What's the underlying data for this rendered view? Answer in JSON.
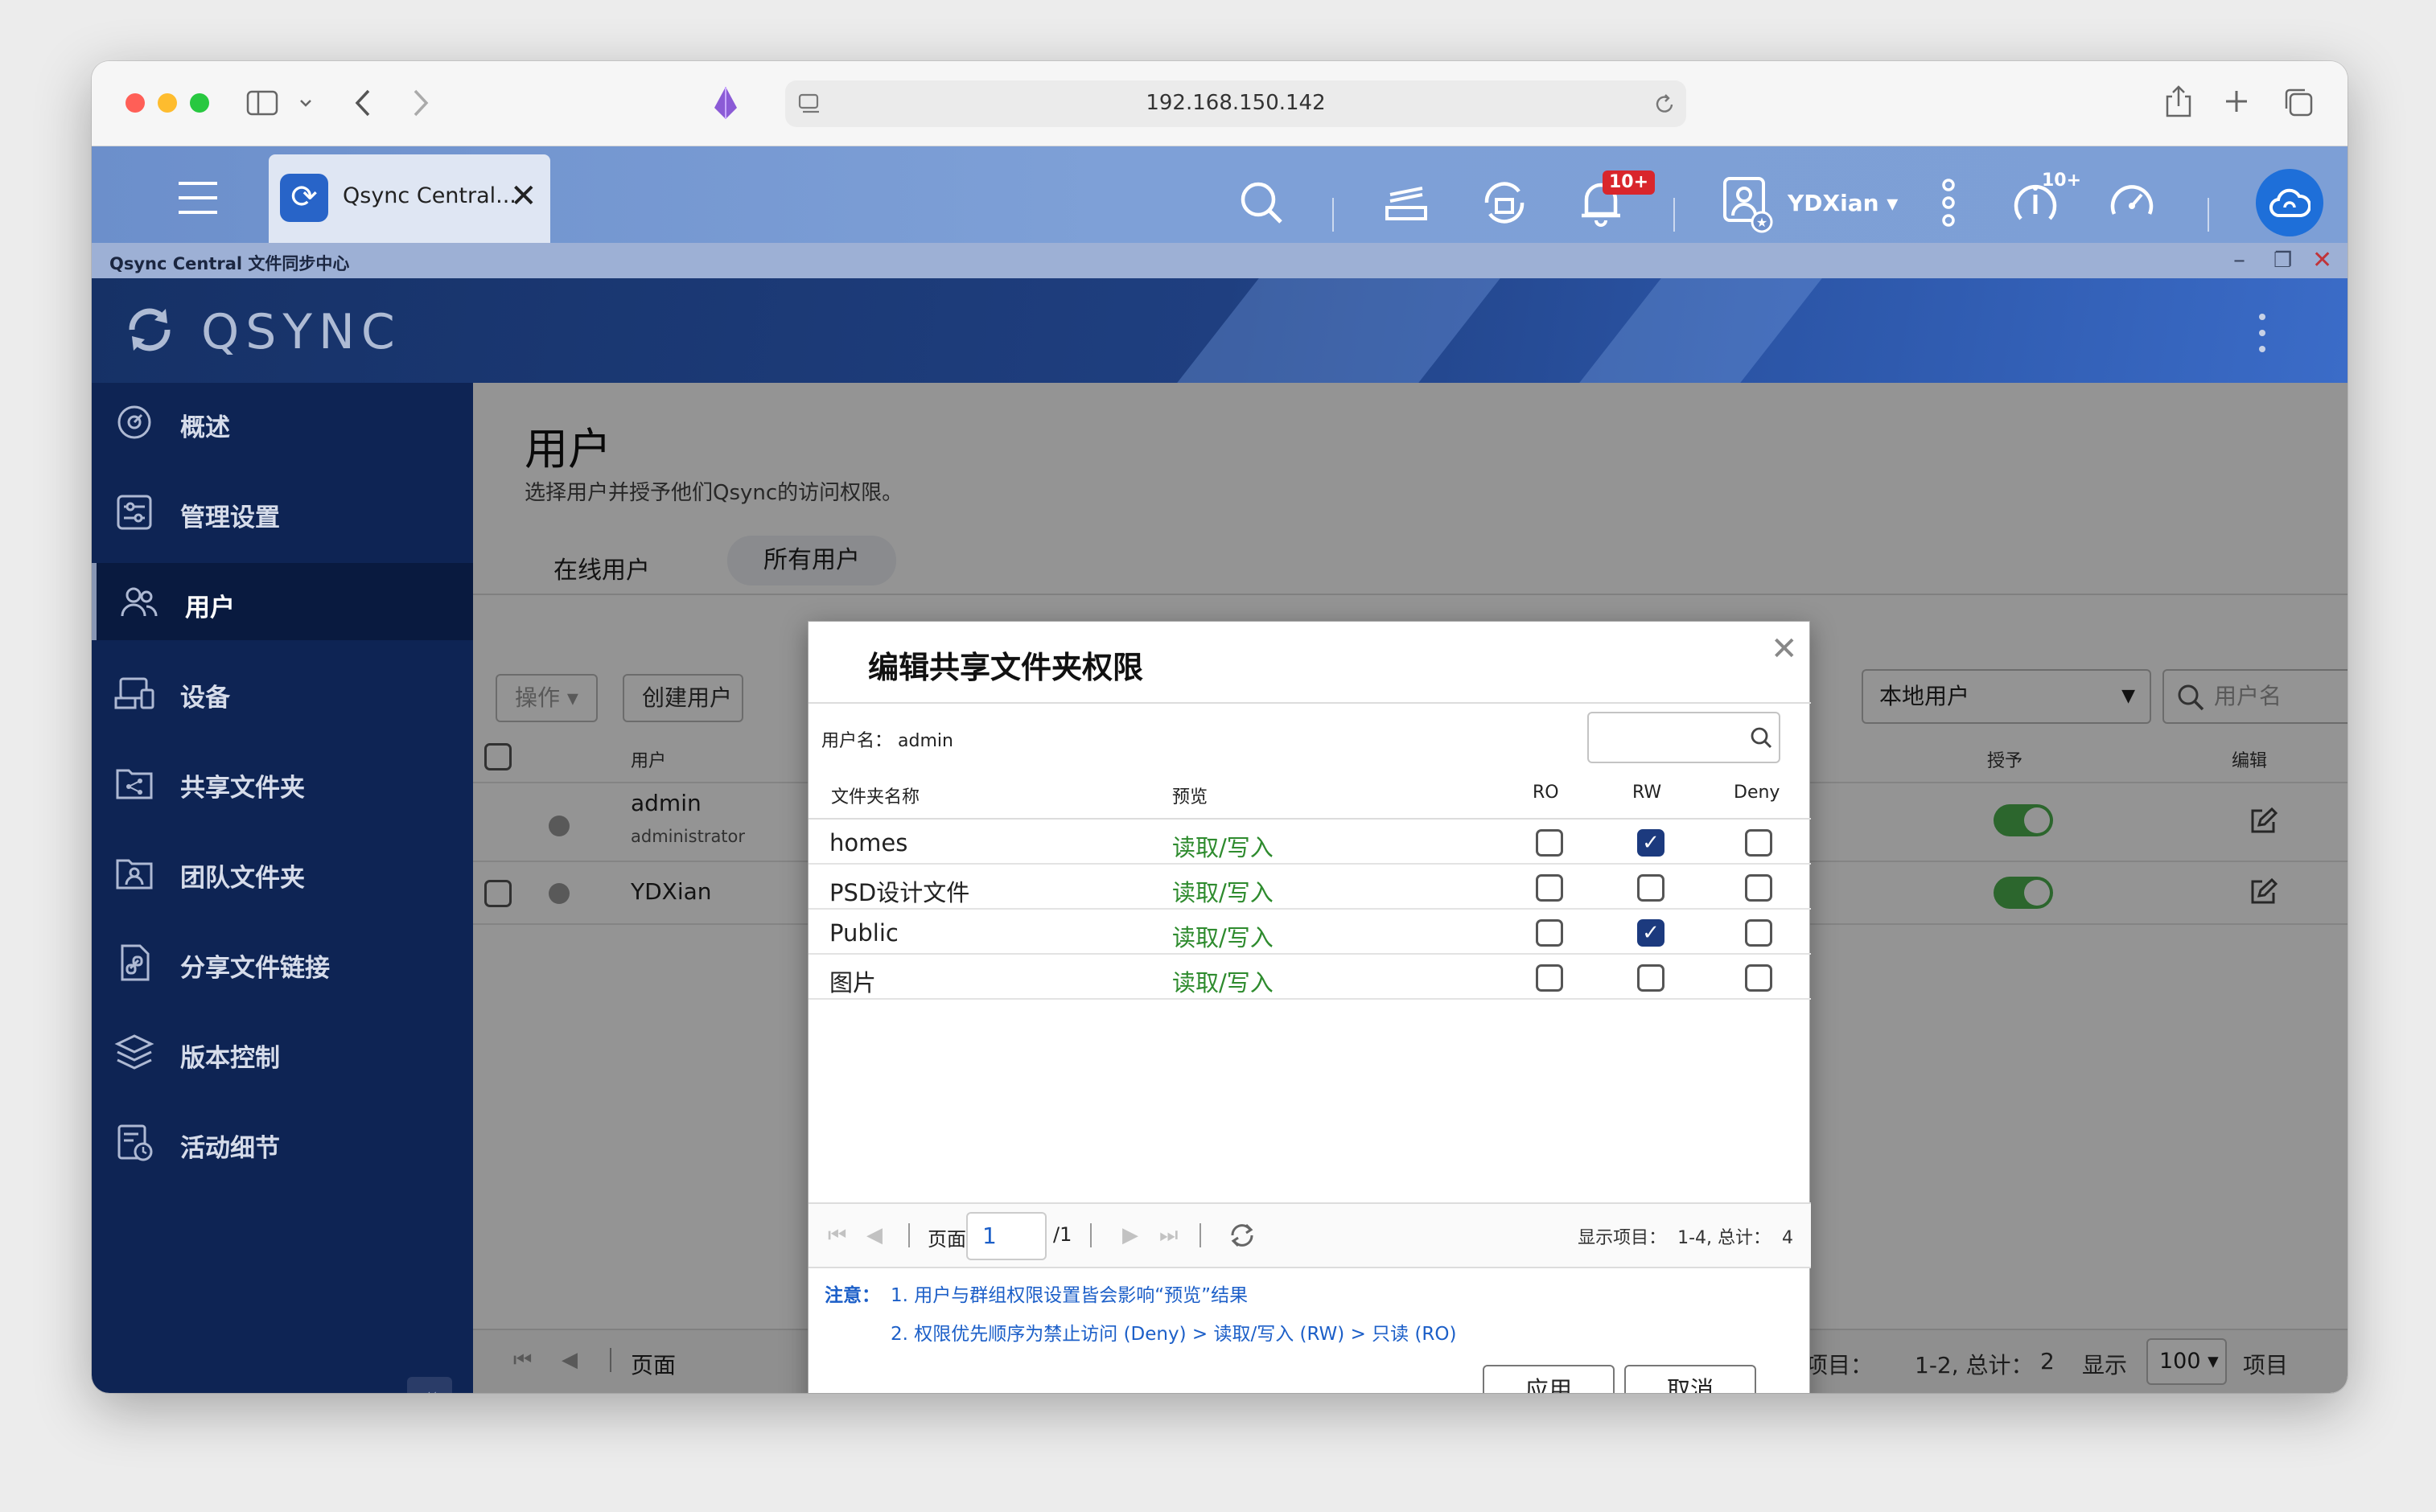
{
  "browser": {
    "url": "192.168.150.142"
  },
  "qts": {
    "app_tab_label": "Qsync Central...",
    "notifications_badge": "10+",
    "user_name": "YDXian",
    "updates_badge": "10+"
  },
  "app_window": {
    "title": "Qsync Central 文件同步中心"
  },
  "banner": {
    "logo": "QSYNC"
  },
  "sidebar": {
    "items": [
      {
        "label": "概述",
        "icon": "overview-icon"
      },
      {
        "label": "管理设置",
        "icon": "settings-icon"
      },
      {
        "label": "用户",
        "icon": "users-icon"
      },
      {
        "label": "设备",
        "icon": "devices-icon"
      },
      {
        "label": "共享文件夹",
        "icon": "shared-folder-icon"
      },
      {
        "label": "团队文件夹",
        "icon": "team-folder-icon"
      },
      {
        "label": "分享文件链接",
        "icon": "share-link-icon"
      },
      {
        "label": "版本控制",
        "icon": "version-icon"
      },
      {
        "label": "活动细节",
        "icon": "activity-icon"
      }
    ],
    "active_index": 2
  },
  "main": {
    "title": "用户",
    "subtitle": "选择用户并授予他们Qsync的访问权限。",
    "tabs": [
      "在线用户",
      "所有用户"
    ],
    "action_button": "操作",
    "create_button": "创建用户",
    "user_type_select": "本地用户",
    "search_placeholder": "用户名",
    "columns": {
      "user": "用户",
      "grant": "授予",
      "edit": "编辑"
    },
    "rows": [
      {
        "name": "admin",
        "role": "administrator",
        "granted": true
      },
      {
        "name": "YDXian",
        "role": "",
        "granted": true
      }
    ],
    "footer": {
      "page_label": "页面",
      "display_items_label": "显示项目：",
      "display_range": "1-2, 总计：",
      "display_total": "2",
      "show_label": "显示",
      "page_size": "100",
      "items_suffix": "项目"
    }
  },
  "modal": {
    "title": "编辑共享文件夹权限",
    "username_label": "用户名：",
    "username": "admin",
    "columns": {
      "folder": "文件夹名称",
      "preview": "预览",
      "ro": "RO",
      "rw": "RW",
      "deny": "Deny"
    },
    "rows": [
      {
        "folder": "homes",
        "preview": "读取/写入",
        "ro": false,
        "rw": true,
        "deny": false
      },
      {
        "folder": "PSD设计文件",
        "preview": "读取/写入",
        "ro": false,
        "rw": false,
        "deny": false
      },
      {
        "folder": "Public",
        "preview": "读取/写入",
        "ro": false,
        "rw": true,
        "deny": false
      },
      {
        "folder": "图片",
        "preview": "读取/写入",
        "ro": false,
        "rw": false,
        "deny": false
      }
    ],
    "pager": {
      "page_label": "页面",
      "page_value": "1",
      "page_total": "/1",
      "display_info": "显示项目：  1-4, 总计：  4"
    },
    "notes_label": "注意：",
    "notes": [
      "1. 用户与群组权限设置皆会影响“预览”结果",
      "2. 权限优先顺序为禁止访问 (Deny) > 读取/写入 (RW) > 只读 (RO)"
    ],
    "apply_button": "应用",
    "cancel_button": "取消"
  },
  "colors": {
    "sidebar_bg": "#0e2454",
    "accent": "#1c3a7e",
    "preview_green": "#2e8b2e",
    "note_blue": "#1c5fc8"
  }
}
